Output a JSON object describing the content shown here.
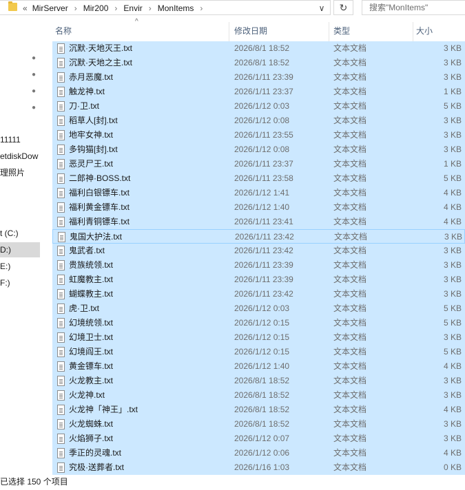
{
  "address_bar": {
    "overflow": "«",
    "crumbs": [
      "MirServer",
      "Mir200",
      "Envir",
      "MonItems"
    ],
    "separator": "›",
    "dropdown_icon": "∨",
    "refresh_icon": "↻"
  },
  "search": {
    "placeholder": "搜索\"MonItems\""
  },
  "nav_pane": {
    "pin_icon": "📌",
    "items": [
      "11111",
      "etdiskDow",
      "理照片",
      "t (C:)",
      "D:)",
      "E:)",
      "F:)"
    ]
  },
  "columns": {
    "name": "名称",
    "date": "修改日期",
    "type": "类型",
    "size": "大小",
    "sort_indicator": "^"
  },
  "files": [
    {
      "name": "沉默·天地灭王.txt",
      "date": "2026/8/1 18:52",
      "type": "文本文档",
      "size": "3 KB"
    },
    {
      "name": "沉默·天地之主.txt",
      "date": "2026/8/1 18:52",
      "type": "文本文档",
      "size": "3 KB"
    },
    {
      "name": "赤月恶魔.txt",
      "date": "2026/1/11 23:39",
      "type": "文本文档",
      "size": "3 KB"
    },
    {
      "name": "触龙神.txt",
      "date": "2026/1/11 23:37",
      "type": "文本文档",
      "size": "1 KB"
    },
    {
      "name": "刀·卫.txt",
      "date": "2026/1/12 0:03",
      "type": "文本文档",
      "size": "5 KB"
    },
    {
      "name": "稻草人[封].txt",
      "date": "2026/1/12 0:08",
      "type": "文本文档",
      "size": "3 KB"
    },
    {
      "name": "地牢女神.txt",
      "date": "2026/1/11 23:55",
      "type": "文本文档",
      "size": "3 KB"
    },
    {
      "name": "多钩猫[封].txt",
      "date": "2026/1/12 0:08",
      "type": "文本文档",
      "size": "3 KB"
    },
    {
      "name": "恶灵尸王.txt",
      "date": "2026/1/11 23:37",
      "type": "文本文档",
      "size": "1 KB"
    },
    {
      "name": "二郎神·BOSS.txt",
      "date": "2026/1/11 23:58",
      "type": "文本文档",
      "size": "5 KB"
    },
    {
      "name": "福利白银镖车.txt",
      "date": "2026/1/12 1:41",
      "type": "文本文档",
      "size": "4 KB"
    },
    {
      "name": "福利黄金镖车.txt",
      "date": "2026/1/12 1:40",
      "type": "文本文档",
      "size": "4 KB"
    },
    {
      "name": "福利青铜镖车.txt",
      "date": "2026/1/11 23:41",
      "type": "文本文档",
      "size": "4 KB"
    },
    {
      "name": "鬼国大护法.txt",
      "date": "2026/1/11 23:42",
      "type": "文本文档",
      "size": "3 KB",
      "focused": true
    },
    {
      "name": "鬼武者.txt",
      "date": "2026/1/11 23:42",
      "type": "文本文档",
      "size": "3 KB"
    },
    {
      "name": "贵族统领.txt",
      "date": "2026/1/11 23:39",
      "type": "文本文档",
      "size": "3 KB"
    },
    {
      "name": "虹魔教主.txt",
      "date": "2026/1/11 23:39",
      "type": "文本文档",
      "size": "3 KB"
    },
    {
      "name": "蝴蝶教主.txt",
      "date": "2026/1/11 23:42",
      "type": "文本文档",
      "size": "3 KB"
    },
    {
      "name": "虎·卫.txt",
      "date": "2026/1/12 0:03",
      "type": "文本文档",
      "size": "5 KB"
    },
    {
      "name": "幻境统领.txt",
      "date": "2026/1/12 0:15",
      "type": "文本文档",
      "size": "5 KB"
    },
    {
      "name": "幻境卫士.txt",
      "date": "2026/1/12 0:15",
      "type": "文本文档",
      "size": "3 KB"
    },
    {
      "name": "幻境阎王.txt",
      "date": "2026/1/12 0:15",
      "type": "文本文档",
      "size": "5 KB"
    },
    {
      "name": "黄金镖车.txt",
      "date": "2026/1/12 1:40",
      "type": "文本文档",
      "size": "4 KB"
    },
    {
      "name": "火龙教主.txt",
      "date": "2026/8/1 18:52",
      "type": "文本文档",
      "size": "3 KB"
    },
    {
      "name": "火龙神.txt",
      "date": "2026/8/1 18:52",
      "type": "文本文档",
      "size": "3 KB"
    },
    {
      "name": "火龙神「神王」.txt",
      "date": "2026/8/1 18:52",
      "type": "文本文档",
      "size": "4 KB"
    },
    {
      "name": "火龙蜘蛛.txt",
      "date": "2026/8/1 18:52",
      "type": "文本文档",
      "size": "3 KB"
    },
    {
      "name": "火焰狮子.txt",
      "date": "2026/1/12 0:07",
      "type": "文本文档",
      "size": "3 KB"
    },
    {
      "name": "季正的灵魂.txt",
      "date": "2026/1/12 0:06",
      "type": "文本文档",
      "size": "4 KB"
    },
    {
      "name": "究极·送葬者.txt",
      "date": "2026/1/16 1:03",
      "type": "文本文档",
      "size": "0 KB"
    }
  ],
  "status_bar": {
    "selection_text": "已选择 150 个项目"
  }
}
